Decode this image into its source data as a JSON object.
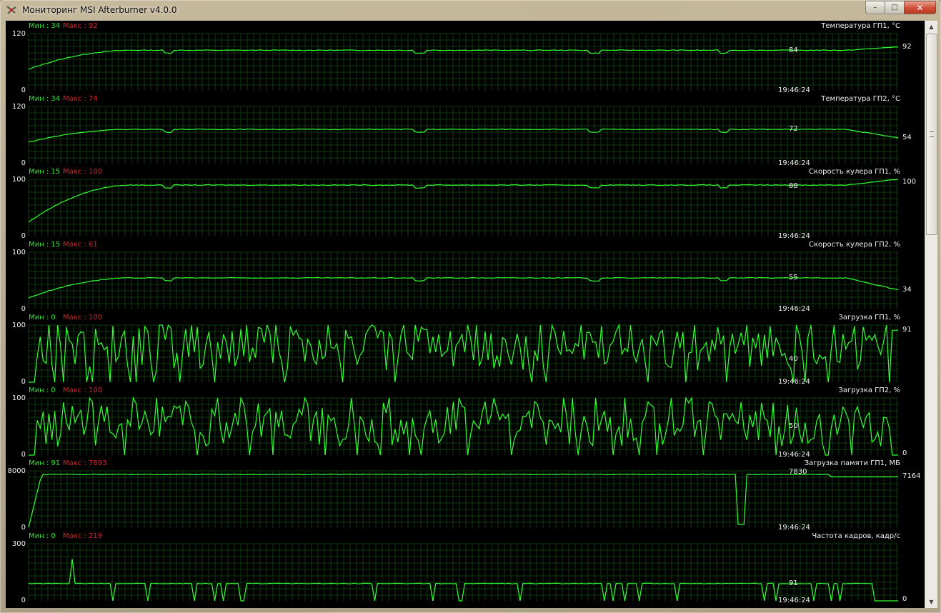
{
  "window": {
    "title": "Мониторинг MSI Afterburner v4.0.0"
  },
  "controls": {
    "minimize": "–",
    "maximize": "□",
    "close": "✕"
  },
  "colors": {
    "line": "#33ff33",
    "grid": "#0e3a0e",
    "min": "#2ee82e",
    "max": "#e02020"
  },
  "graphs": [
    {
      "min_label": "Мин : 34",
      "max_label": "Макс : 92",
      "title": "Температура ГП1, °C",
      "ymax": "120",
      "ymin": "0",
      "time": "19:46:24",
      "cursor_value": "84",
      "current_value": "92",
      "mode": "smooth",
      "start": 45,
      "plateau": 85,
      "end": 92
    },
    {
      "min_label": "Мин : 34",
      "max_label": "Макс : 74",
      "title": "Температура ГП2, °C",
      "ymax": "120",
      "ymin": "0",
      "time": "19:46:24",
      "cursor_value": "72",
      "current_value": "54",
      "mode": "smooth",
      "start": 45,
      "plateau": 72,
      "end": 54
    },
    {
      "min_label": "Мин : 15",
      "max_label": "Макс : 100",
      "title": "Скорость кулера ГП1, %",
      "ymax": "100",
      "ymin": "0",
      "time": "19:46:24",
      "cursor_value": "88",
      "current_value": "100",
      "mode": "smooth",
      "start": 25,
      "plateau": 90,
      "end": 100
    },
    {
      "min_label": "Мин : 15",
      "max_label": "Макс : 61",
      "title": "Скорость кулера ГП2, %",
      "ymax": "100",
      "ymin": "0",
      "time": "19:46:24",
      "cursor_value": "55",
      "current_value": "34",
      "mode": "smooth",
      "start": 20,
      "plateau": 55,
      "end": 34
    },
    {
      "min_label": "Мин : 0",
      "max_label": "Макс : 100",
      "title": "Загрузка ГП1, %",
      "ymax": "100",
      "ymin": "0",
      "time": "19:46:24",
      "cursor_value": "40",
      "current_value": "91",
      "mode": "noisy",
      "start": 0,
      "plateau": 60,
      "end": 91
    },
    {
      "min_label": "Мин : 0",
      "max_label": "Макс : 100",
      "title": "Загрузка ГП2, %",
      "ymax": "100",
      "ymin": "0",
      "time": "19:46:24",
      "cursor_value": "50",
      "current_value": "0",
      "mode": "noisy",
      "start": 0,
      "plateau": 55,
      "end": 0
    },
    {
      "min_label": "Мин : 91",
      "max_label": "Макс : 7893",
      "title": "Загрузка памяти ГП1, МБ",
      "ymax": "8000",
      "ymin": "0",
      "time": "19:46:24",
      "cursor_value": "7830",
      "current_value": "7164",
      "mode": "memory",
      "start": 100,
      "plateau": 7500,
      "end": 7164
    },
    {
      "min_label": "Мин : 0",
      "max_label": "Макс : 219",
      "title": "Частота кадров, кадр/с",
      "ymax": "300",
      "ymin": "0",
      "time": "19:46:24",
      "cursor_value": "91",
      "current_value": "0",
      "mode": "fps",
      "start": 0,
      "plateau": 91,
      "end": 0
    }
  ]
}
